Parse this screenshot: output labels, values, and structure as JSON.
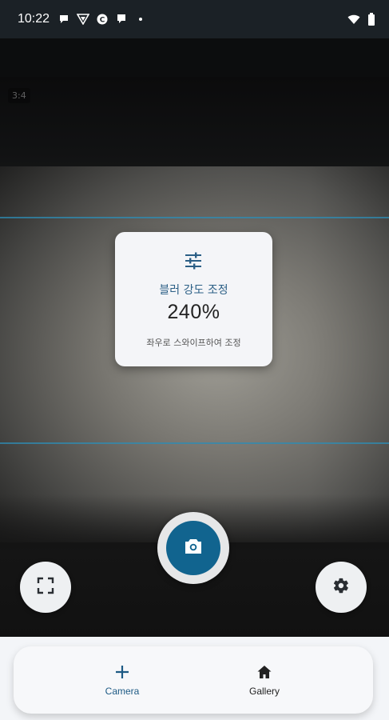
{
  "status_bar": {
    "time": "10:22",
    "left_icons": [
      "chat-bubble-icon",
      "vpn-icon",
      "circle-c-icon",
      "message-icon",
      "dot-icon"
    ],
    "right_icons": [
      "wifi-icon",
      "battery-icon"
    ]
  },
  "preview": {
    "aspect_ratio_label": "3:4"
  },
  "blur_card": {
    "icon": "tune-sliders-icon",
    "title": "블러 강도 조정",
    "value": "240%",
    "hint": "좌우로 스와이프하여 조정"
  },
  "controls": {
    "left_icon": "fullscreen-icon",
    "shutter_icon": "camera-icon",
    "right_icon": "gear-icon"
  },
  "bottom_nav": {
    "items": [
      {
        "label": "Camera",
        "icon": "plus-icon",
        "active": true
      },
      {
        "label": "Gallery",
        "icon": "home-icon",
        "active": false
      }
    ]
  },
  "colors": {
    "accent": "#11648f",
    "grid_line": "#2d8cb4",
    "card_title": "#2b5f86"
  }
}
